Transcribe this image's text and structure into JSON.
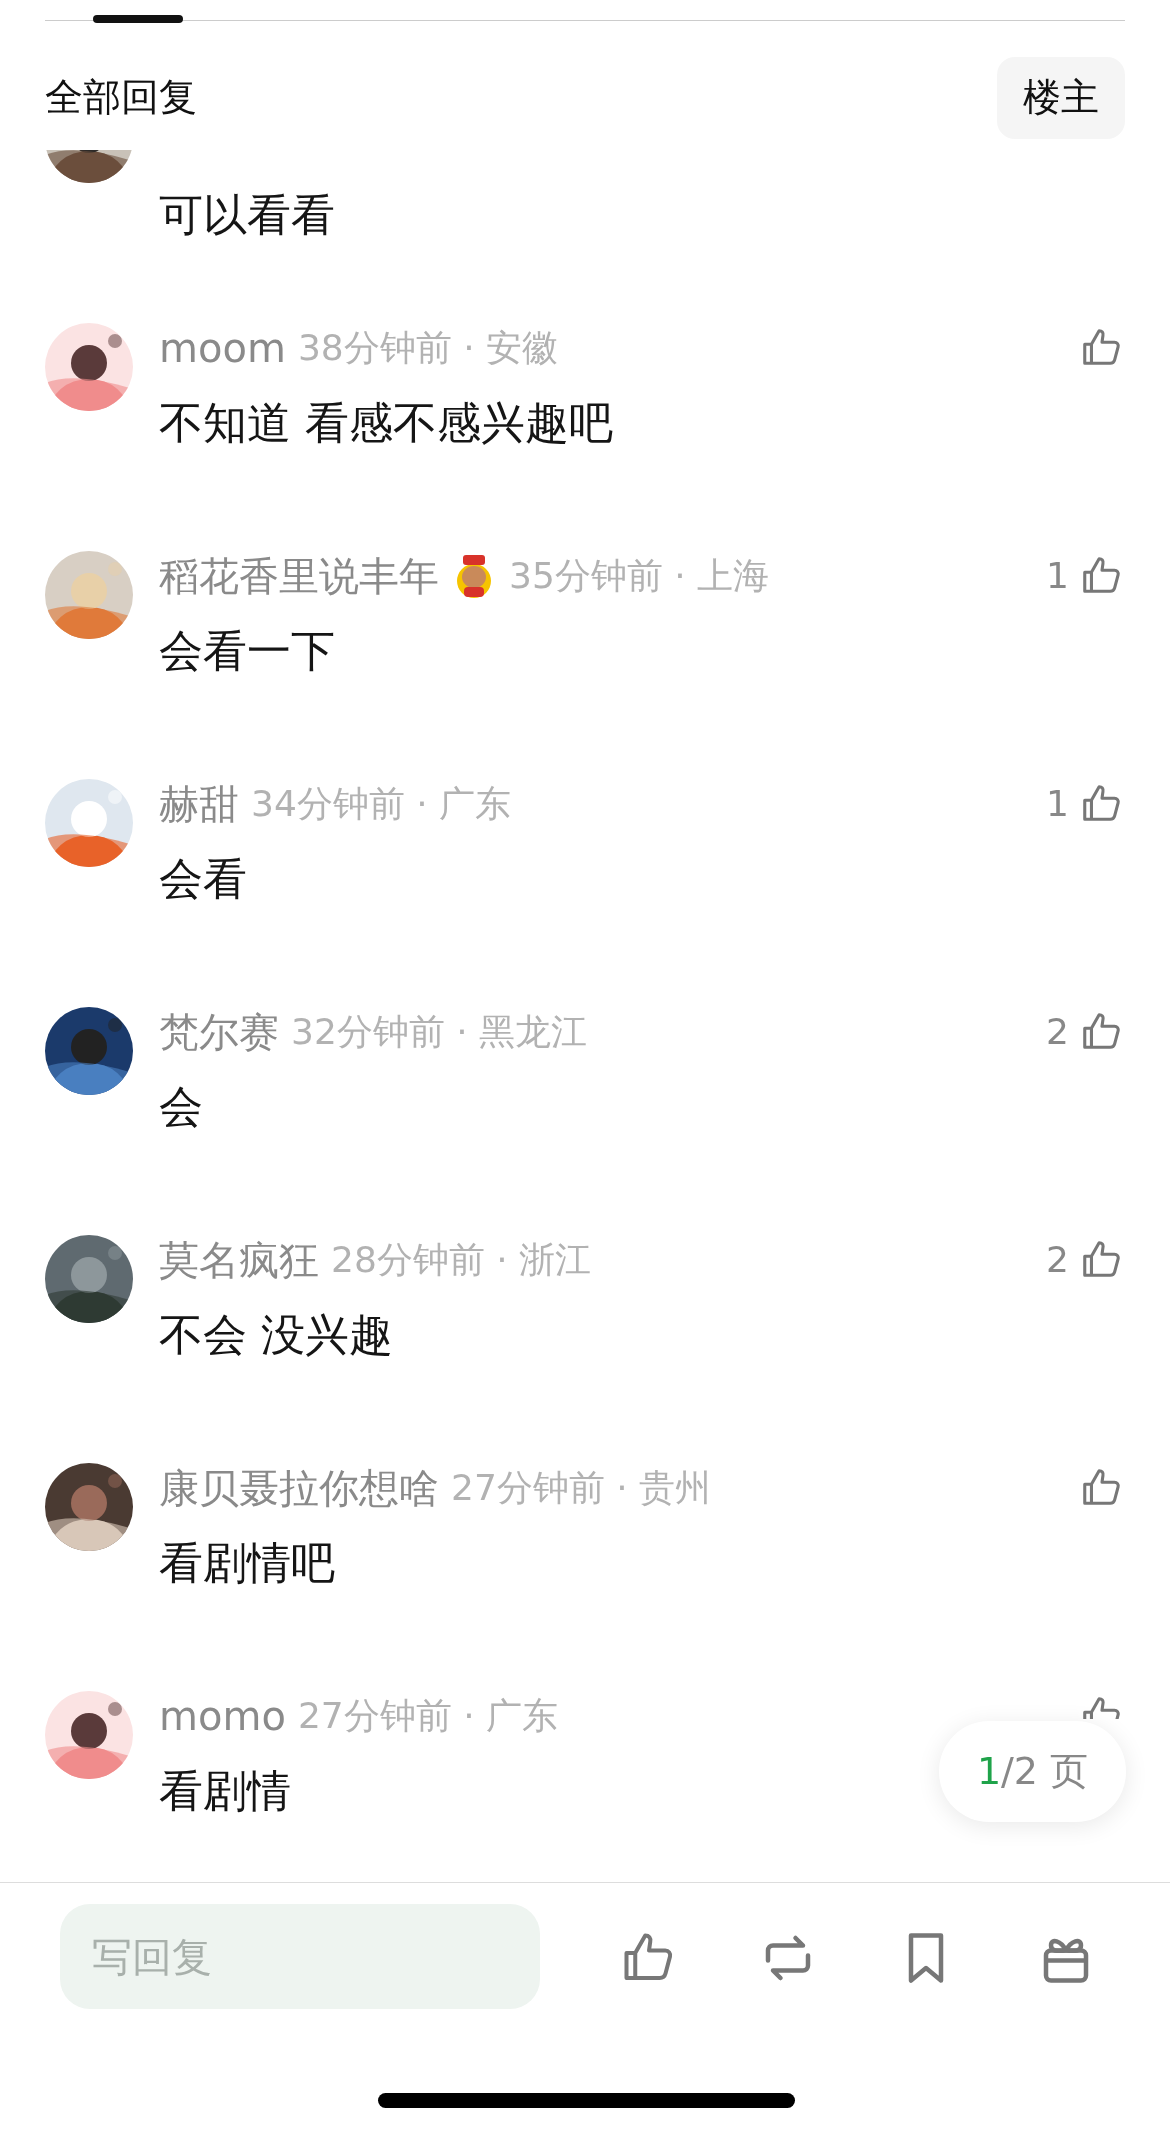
{
  "header": {
    "title": "全部回复",
    "filter_button": "楼主"
  },
  "comments": [
    {
      "text": "可以看看"
    },
    {
      "user": "moom",
      "time": "38分钟前 · 安徽",
      "text": "不知道  看感不感兴趣吧"
    },
    {
      "user": "稻花香里说丰年",
      "badge": true,
      "time": "35分钟前 · 上海",
      "text": "会看一下",
      "likes": "1"
    },
    {
      "user": "赫甜",
      "time": "34分钟前 · 广东",
      "text": "会看",
      "likes": "1"
    },
    {
      "user": "梵尔赛",
      "time": "32分钟前 · 黑龙江",
      "text": "会",
      "likes": "2"
    },
    {
      "user": "莫名疯狂",
      "time": "28分钟前 · 浙江",
      "text": "不会 没兴趣",
      "likes": "2"
    },
    {
      "user": "康贝聂拉你想啥",
      "time": "27分钟前 · 贵州",
      "text": "看剧情吧"
    },
    {
      "user": "momo",
      "time": "27分钟前 · 广东",
      "text": "看剧情"
    }
  ],
  "pager": {
    "current": "1",
    "rest": "/2 页"
  },
  "reply_bar": {
    "placeholder": "写回复"
  }
}
